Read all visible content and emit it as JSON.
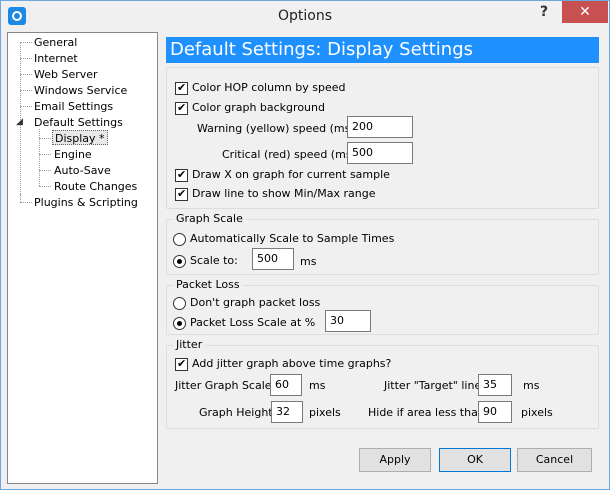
{
  "window": {
    "title": "Options",
    "help_glyph": "?",
    "close_glyph": "✕"
  },
  "tree": {
    "items": [
      {
        "label": "General"
      },
      {
        "label": "Internet"
      },
      {
        "label": "Web Server"
      },
      {
        "label": "Windows Service"
      },
      {
        "label": "Email Settings"
      },
      {
        "label": "Default Settings",
        "expanded": true
      },
      {
        "label": "Display *",
        "selected": true
      },
      {
        "label": "Engine"
      },
      {
        "label": "Auto-Save"
      },
      {
        "label": "Route Changes"
      },
      {
        "label": "Plugins & Scripting"
      }
    ],
    "expander": "◢"
  },
  "header": {
    "title": "Default Settings: Display Settings",
    "background": "#1e90ff"
  },
  "display": {
    "color_hop": {
      "label": "Color HOP column by speed",
      "checked": true
    },
    "color_graph": {
      "label": "Color graph background",
      "checked": true
    },
    "warning_label": "Warning (yellow) speed (ms):",
    "warning_value": "200",
    "critical_label": "Critical (red) speed (ms):",
    "critical_value": "500",
    "draw_x": {
      "label": "Draw X on graph for current sample",
      "checked": true
    },
    "draw_line": {
      "label": "Draw line to show Min/Max range",
      "checked": true
    }
  },
  "graph_scale": {
    "title": "Graph Scale",
    "auto_label": "Automatically Scale to Sample Times",
    "scale_label": "Scale to:",
    "scale_value": "500",
    "scale_unit": "ms",
    "selected": "scale"
  },
  "packet_loss": {
    "title": "Packet Loss",
    "dont_label": "Don't graph packet loss",
    "scale_label": "Packet Loss Scale at %",
    "scale_value": "30",
    "selected": "scale"
  },
  "jitter": {
    "title": "Jitter",
    "add_label": "Add jitter graph above time graphs?",
    "add_checked": true,
    "scale_label": "Jitter Graph Scale:",
    "scale_value": "60",
    "scale_unit": "ms",
    "target_label": "Jitter \"Target\" line:",
    "target_value": "35",
    "target_unit": "ms",
    "height_label": "Graph Height:",
    "height_value": "32",
    "height_unit": "pixels",
    "hide_label": "Hide if area less than",
    "hide_value": "90",
    "hide_unit": "pixels"
  },
  "buttons": {
    "apply": "Apply",
    "ok": "OK",
    "cancel": "Cancel"
  }
}
